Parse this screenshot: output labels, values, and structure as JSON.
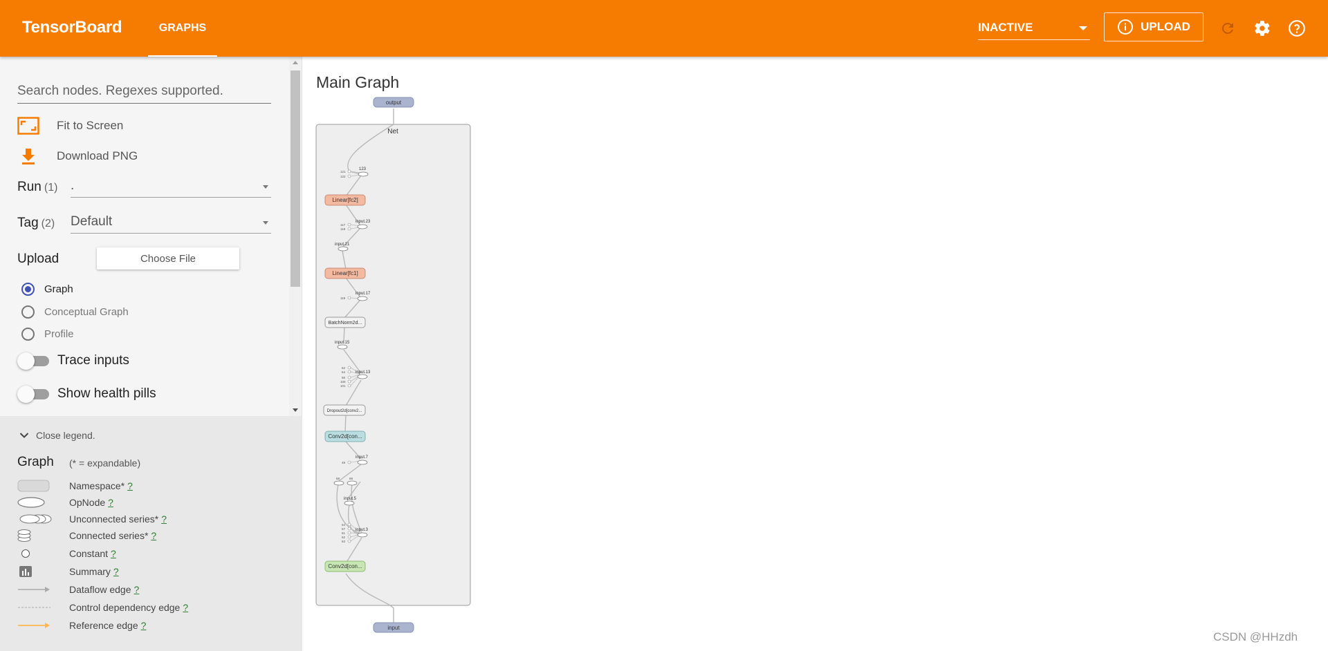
{
  "app": {
    "title": "TensorBoard",
    "tab": "GRAPHS",
    "run_dropdown_value": "INACTIVE",
    "upload_label": "UPLOAD",
    "accent_color": "#f57c00"
  },
  "sidebar": {
    "search_placeholder": "Search nodes. Regexes supported.",
    "fit_to_screen": "Fit to Screen",
    "download_png": "Download PNG",
    "run_label": "Run",
    "run_count": "(1)",
    "run_value": ".",
    "tag_label": "Tag",
    "tag_count": "(2)",
    "tag_value": "Default",
    "upload_label": "Upload",
    "choose_file": "Choose File",
    "radios": [
      {
        "label": "Graph",
        "checked": true
      },
      {
        "label": "Conceptual Graph",
        "checked": false
      },
      {
        "label": "Profile",
        "checked": false
      }
    ],
    "trace_inputs": "Trace inputs",
    "show_health_pills": "Show health pills"
  },
  "legend": {
    "toggle": "Close legend.",
    "title": "Graph",
    "subtitle": "(* = expandable)",
    "help_mark": "?",
    "items": [
      {
        "label": "Namespace*",
        "icon": "namespace-icon"
      },
      {
        "label": "OpNode",
        "icon": "opnode-icon"
      },
      {
        "label": "Unconnected series*",
        "icon": "unconnected-series-icon"
      },
      {
        "label": "Connected series*",
        "icon": "connected-series-icon"
      },
      {
        "label": "Constant",
        "icon": "constant-icon"
      },
      {
        "label": "Summary",
        "icon": "summary-icon"
      },
      {
        "label": "Dataflow edge",
        "icon": "dataflow-edge-icon"
      },
      {
        "label": "Control dependency edge",
        "icon": "control-edge-icon"
      },
      {
        "label": "Reference edge",
        "icon": "reference-edge-icon"
      }
    ]
  },
  "main": {
    "title": "Main Graph",
    "graph": {
      "namespace": "Net",
      "output_node": "output",
      "input_node": "input",
      "modules": [
        {
          "label": "Linear[fc2]",
          "color": "#f4b9a1"
        },
        {
          "label": "Linear[fc1]",
          "color": "#f4b9a1"
        },
        {
          "label": "BatchNorm2d...",
          "color": "#f0f0f0"
        },
        {
          "label": "Dropout2d[conv2...",
          "color": "#f0f0f0"
        },
        {
          "label": "Conv2d[con...",
          "color": "#b9dde0"
        },
        {
          "label": "Conv2d[con...",
          "color": "#c8e6b4"
        }
      ],
      "op_labels": [
        "123",
        "input.23",
        "input.21",
        "input.17",
        "input.15",
        "input.13",
        "input.7",
        "input.5",
        "input.3"
      ],
      "small_labels": [
        "121",
        "122",
        "117",
        "118",
        "119",
        "62",
        "64",
        "66",
        "100",
        "101",
        "49",
        "68",
        "69",
        "54",
        "57",
        "61",
        "62",
        "63"
      ]
    }
  },
  "watermark": "CSDN @HHzdh"
}
